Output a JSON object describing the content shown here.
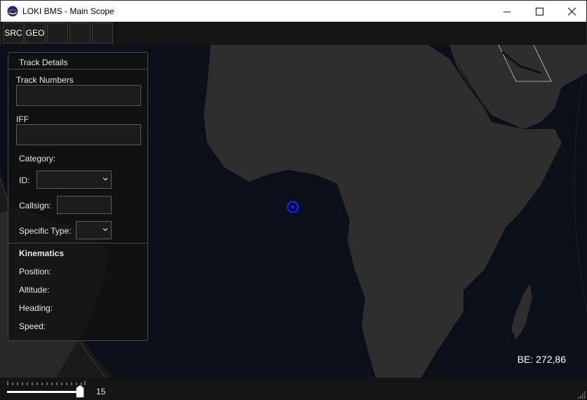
{
  "window": {
    "title": "LOKI BMS - Main Scope",
    "app_icon": "loki-logo-icon",
    "controls": [
      "minimize-icon",
      "maximize-icon",
      "close-icon"
    ]
  },
  "toolbar": {
    "buttons": [
      "SRC",
      "GEO",
      "",
      "",
      ""
    ]
  },
  "map": {
    "be_readout": "BE: 272,86",
    "track_marker": "blue-circle-icon",
    "colors": {
      "ocean": "#0b0f17",
      "land": "#2e2e2e",
      "marker": "#1a1aff"
    }
  },
  "track_details": {
    "header": "Track Details",
    "track_numbers_label": "Track Numbers",
    "track_numbers_value": "",
    "iff_label": "IFF",
    "iff_value": "",
    "category_label": "Category:",
    "id_label": "ID:",
    "id_value": "",
    "callsign_label": "Callsign:",
    "callsign_value": "",
    "specific_type_label": "Specific Type:",
    "specific_type_value": "",
    "kinematics_heading": "Kinematics",
    "position_label": "Position:",
    "altitude_label": "Altitude:",
    "heading_label": "Heading:",
    "speed_label": "Speed:"
  },
  "zoom": {
    "value": "15"
  }
}
